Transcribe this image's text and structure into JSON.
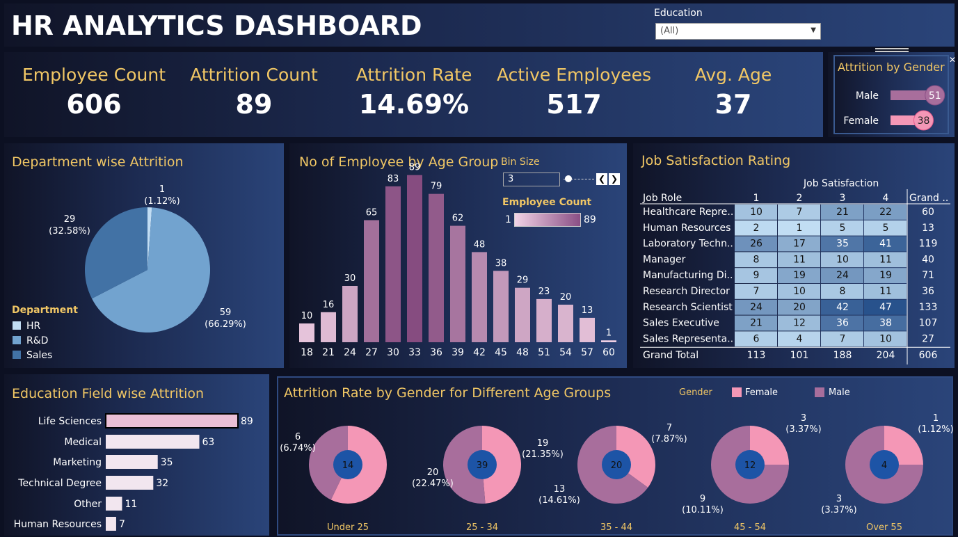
{
  "header": {
    "title": "HR ANALYTICS DASHBOARD",
    "filter_label": "Education",
    "filter_value": "(All)"
  },
  "kpis": [
    {
      "label": "Employee Count",
      "value": "606"
    },
    {
      "label": "Attrition Count",
      "value": "89"
    },
    {
      "label": "Attrition Rate",
      "value": "14.69%"
    },
    {
      "label": "Active Employees",
      "value": "517"
    },
    {
      "label": "Avg. Age",
      "value": "37"
    }
  ],
  "colors": {
    "gold": "#f1c765",
    "hr": "#c2ddf3",
    "rd": "#72a3cf",
    "sales": "#4272a5",
    "female": "#f497b6",
    "male": "#a86e9c",
    "center": "#1d54a6"
  },
  "chart_data": [
    {
      "id": "gender",
      "type": "bar",
      "title": "Attrition by Gender",
      "categories": [
        "Male",
        "Female"
      ],
      "values": [
        51,
        38
      ]
    },
    {
      "id": "dept",
      "type": "pie",
      "title": "Department wise Attrition",
      "legend_title": "Department",
      "legend_position": "bottom-left",
      "categories": [
        "HR",
        "R&D",
        "Sales"
      ],
      "values": [
        1,
        59,
        29
      ],
      "labels": [
        [
          "1",
          "(1.12%)"
        ],
        [
          "59",
          "(66.29%)"
        ],
        [
          "29",
          "(32.58%)"
        ]
      ]
    },
    {
      "id": "age",
      "type": "bar",
      "title": "No of Employee by Age Group",
      "bin_size_label": "Bin Size",
      "bin_size": "3",
      "legend_title": "Employee Count",
      "legend_min": "1",
      "legend_max": "89",
      "categories": [
        "18",
        "21",
        "24",
        "27",
        "30",
        "33",
        "36",
        "39",
        "42",
        "45",
        "48",
        "51",
        "54",
        "57",
        "60"
      ],
      "values": [
        10,
        16,
        30,
        65,
        83,
        89,
        79,
        62,
        48,
        38,
        29,
        23,
        20,
        13,
        1
      ]
    },
    {
      "id": "jobsat",
      "type": "table",
      "title": "Job Satisfaction Rating",
      "col_group": "Job Satisfaction",
      "row_header": "Job Role",
      "columns": [
        "1",
        "2",
        "3",
        "4"
      ],
      "total_header": "Grand ..",
      "rows": [
        {
          "role": "Healthcare Repre..",
          "values": [
            10,
            7,
            21,
            22
          ],
          "total": 60
        },
        {
          "role": "Human Resources",
          "values": [
            2,
            1,
            5,
            5
          ],
          "total": 13
        },
        {
          "role": "Laboratory Techn..",
          "values": [
            26,
            17,
            35,
            41
          ],
          "total": 119
        },
        {
          "role": "Manager",
          "values": [
            8,
            11,
            10,
            11
          ],
          "total": 40
        },
        {
          "role": "Manufacturing Di..",
          "values": [
            9,
            19,
            24,
            19
          ],
          "total": 71
        },
        {
          "role": "Research Director",
          "values": [
            7,
            10,
            8,
            11
          ],
          "total": 36
        },
        {
          "role": "Research Scientist",
          "values": [
            24,
            20,
            42,
            47
          ],
          "total": 133
        },
        {
          "role": "Sales Executive",
          "values": [
            21,
            12,
            36,
            38
          ],
          "total": 107
        },
        {
          "role": "Sales Representa..",
          "values": [
            6,
            4,
            7,
            10
          ],
          "total": 27
        }
      ],
      "grand_total": {
        "label": "Grand Total",
        "values": [
          113,
          101,
          188,
          204
        ],
        "total": 606
      }
    },
    {
      "id": "edufield",
      "type": "bar",
      "title": "Education Field wise Attrition",
      "categories": [
        "Life Sciences",
        "Medical",
        "Marketing",
        "Technical Degree",
        "Other",
        "Human Resources"
      ],
      "values": [
        89,
        63,
        35,
        32,
        11,
        7
      ]
    },
    {
      "id": "agegen",
      "type": "pie",
      "title": "Attrition Rate by Gender for Different Age Groups",
      "legend_title": "Gender",
      "legend": [
        "Female",
        "Male"
      ],
      "groups": [
        {
          "name": "Under 25",
          "total": 14,
          "female": 8,
          "male": 6,
          "labels": [
            [
              "6",
              "(6.74%)"
            ]
          ]
        },
        {
          "name": "25 - 34",
          "total": 39,
          "female": 19,
          "male": 20,
          "labels": [
            [
              "19",
              "(21.35%)"
            ],
            [
              "20",
              "(22.47%)"
            ]
          ]
        },
        {
          "name": "35 - 44",
          "total": 20,
          "female": 7,
          "male": 13,
          "labels": [
            [
              "7",
              "(7.87%)"
            ],
            [
              "13",
              "(14.61%)"
            ]
          ]
        },
        {
          "name": "45 - 54",
          "total": 12,
          "female": 3,
          "male": 9,
          "labels": [
            [
              "3",
              "(3.37%)"
            ],
            [
              "9",
              "(10.11%)"
            ]
          ]
        },
        {
          "name": "Over 55",
          "total": 4,
          "female": 1,
          "male": 3,
          "labels": [
            [
              "1",
              "(1.12%)"
            ],
            [
              "3",
              "(3.37%)"
            ]
          ]
        }
      ]
    }
  ]
}
